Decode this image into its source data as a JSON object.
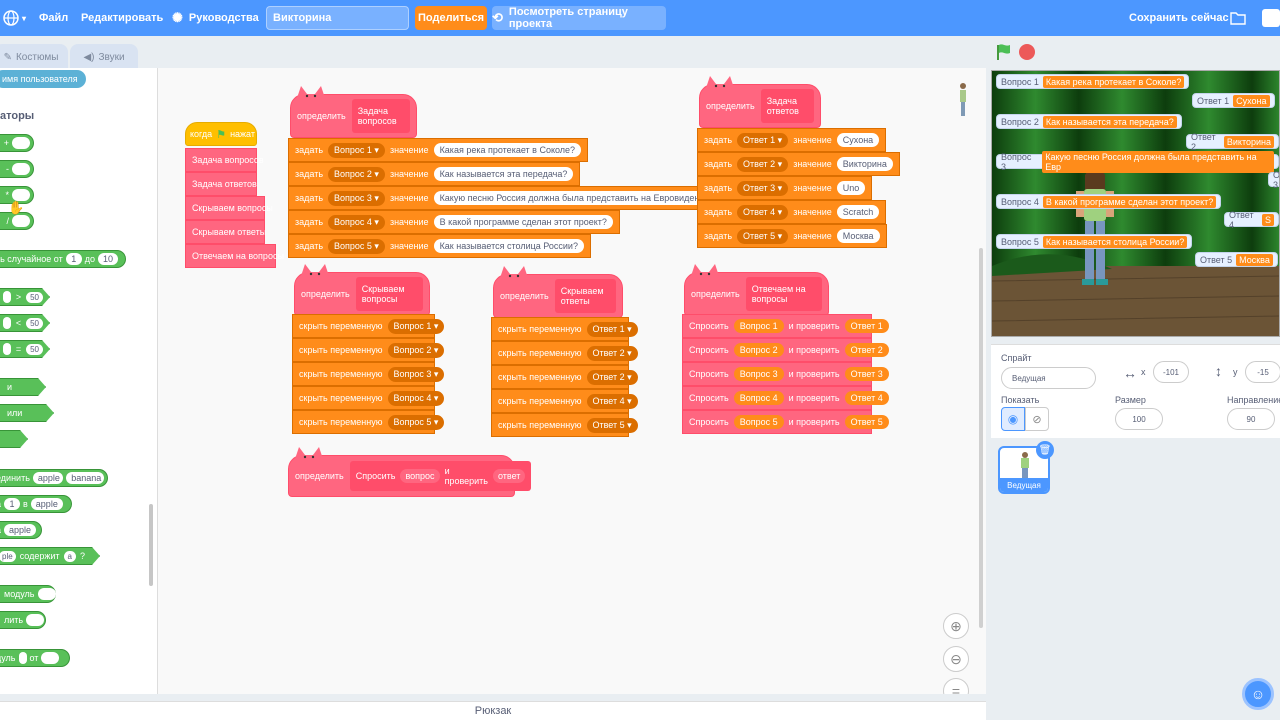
{
  "menu": {
    "file": "Файл",
    "edit": "Редактировать",
    "tutorials": "Руководства",
    "project_title": "Викторина",
    "share": "Поделиться",
    "see_project": "Посмотреть страницу проекта",
    "save": "Сохранить сейчас"
  },
  "tabs": {
    "costumes": "Костюмы",
    "sounds": "Звуки"
  },
  "palette": {
    "username": "имя пользователя",
    "heading": "аторы",
    "random_label": "ть случайное от",
    "random_from": "1",
    "random_to": "10",
    "cmp": [
      ">",
      "<",
      "="
    ],
    "cmp_val": "50",
    "and": "и",
    "or": "или",
    "join_label": "единить",
    "join_a": "apple",
    "join_b": "banana",
    "letter_a": "1",
    "letter_in": "в",
    "letter_b": "apple",
    "length_val": "apple",
    "contains_a": "ple",
    "contains_label": "содержит",
    "contains_b": "a",
    "contains_q": "?",
    "mod": "модуль",
    "round": "лить",
    "abs": "дуль",
    "abs_of": "от"
  },
  "hat": {
    "when": "когда",
    "clicked": "нажат"
  },
  "main_calls": [
    "Задача вопросов",
    "Задача ответов",
    "Скрываем вопросы",
    "Скрываем ответы",
    "Отвечаем на вопросы"
  ],
  "define": "определить",
  "set": "задать",
  "value": "значение",
  "hide_var": "скрыть переменную",
  "ask": "Спросить",
  "and_check": "и проверить",
  "defs": {
    "questions_task": "Задача вопросов",
    "answers_task": "Задача ответов",
    "hide_q": "Скрываем вопросы",
    "hide_a": "Скрываем ответы",
    "answer_q": "Отвечаем на вопросы"
  },
  "questions": [
    {
      "var": "Вопрос 1",
      "text": "Какая река протекает в Соколе?"
    },
    {
      "var": "Вопрос 2",
      "text": "Как называется эта передача?"
    },
    {
      "var": "Вопрос 3",
      "text": "Какую песню Россия должна была представить на Евровидении?"
    },
    {
      "var": "Вопрос 4",
      "text": "В какой программе сделан этот проект?"
    },
    {
      "var": "Вопрос 5",
      "text": "Как называется столица России?"
    }
  ],
  "answers": [
    {
      "var": "Ответ 1",
      "text": "Сухона"
    },
    {
      "var": "Ответ 2",
      "text": "Викторина"
    },
    {
      "var": "Ответ 3",
      "text": "Uno"
    },
    {
      "var": "Ответ 4",
      "text": "Scratch"
    },
    {
      "var": "Ответ 5",
      "text": "Москва"
    }
  ],
  "hide_q_vars": [
    "Вопрос 1",
    "Вопрос 2",
    "Вопрос 3",
    "Вопрос 4",
    "Вопрос 5"
  ],
  "hide_a_vars": [
    "Ответ 1",
    "Ответ 2",
    "Ответ 2",
    "Ответ 4",
    "Ответ 5"
  ],
  "ask_rows": [
    {
      "q": "Вопрос 1",
      "a": "Ответ 1"
    },
    {
      "q": "Вопрос 2",
      "a": "Ответ 2"
    },
    {
      "q": "Вопрос 3",
      "a": "Ответ 3"
    },
    {
      "q": "Вопрос 4",
      "a": "Ответ 4"
    },
    {
      "q": "Вопрос 5",
      "a": "Ответ 5"
    }
  ],
  "ask_def": {
    "label": "Спросить",
    "arg1": "вопрос",
    "mid": "и проверить",
    "arg2": "ответ"
  },
  "backpack": "Рюкзак",
  "stage_monitors": {
    "questions": [
      {
        "label": "Вопрос 1",
        "value": "Какая река протекает в Соколе?"
      },
      {
        "label": "Вопрос 2",
        "value": "Как называется эта передача?"
      },
      {
        "label": "Вопрос 3",
        "value": "Какую песню Россия должна была представить на Евр"
      },
      {
        "label": "Вопрос 4",
        "value": "В какой программе сделан этот проект?"
      },
      {
        "label": "Вопрос 5",
        "value": "Как называется столица России?"
      }
    ],
    "answers": [
      {
        "label": "Ответ 1",
        "value": "Сухона"
      },
      {
        "label": "Ответ 2",
        "value": "Викторина"
      },
      {
        "label": "Ответ 3",
        "value": "U"
      },
      {
        "label": "Ответ 4",
        "value": "S"
      },
      {
        "label": "Ответ 5",
        "value": "Москва"
      }
    ]
  },
  "sprite": {
    "label": "Спрайт",
    "name": "Ведущая",
    "x_label": "x",
    "x": "-101",
    "y_label": "y",
    "y": "-15",
    "show_label": "Показать",
    "size_label": "Размер",
    "size": "100",
    "dir_label": "Направление",
    "dir": "90",
    "thumb_name": "Ведущая"
  }
}
